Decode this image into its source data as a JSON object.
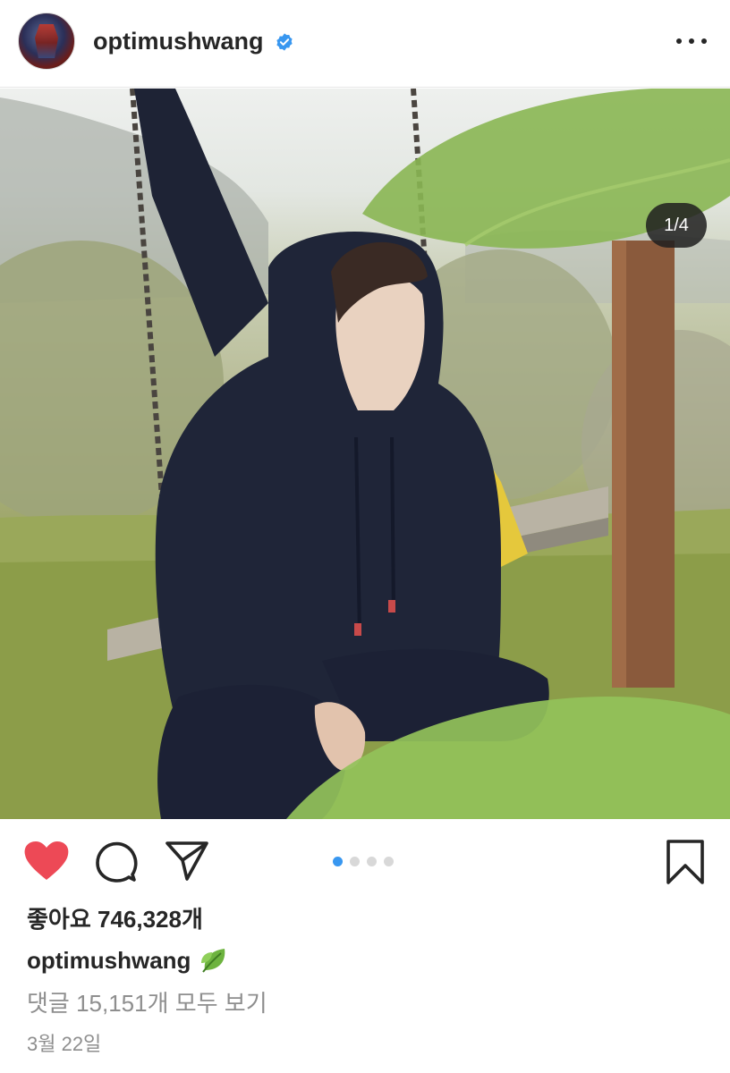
{
  "header": {
    "username": "optimushwang",
    "more_icon": "more-horizontal-icon",
    "verified_icon": "verified-badge-icon"
  },
  "photo": {
    "counter": "1/4",
    "description_icons": [
      "swing",
      "hoodie"
    ]
  },
  "actions": {
    "like_icon": "heart-icon",
    "liked": true,
    "like_color": "#ed4956",
    "comment_icon": "comment-icon",
    "share_icon": "send-icon",
    "save_icon": "bookmark-icon",
    "carousel_total": 4,
    "carousel_active": 1,
    "accent": "#3897f0"
  },
  "post": {
    "likes": "좋아요 746,328개",
    "caption_user": "optimushwang",
    "caption_emoji": "leaf-icon",
    "comments_link": "댓글 15,151개 모두 보기",
    "date": "3월 22일"
  }
}
